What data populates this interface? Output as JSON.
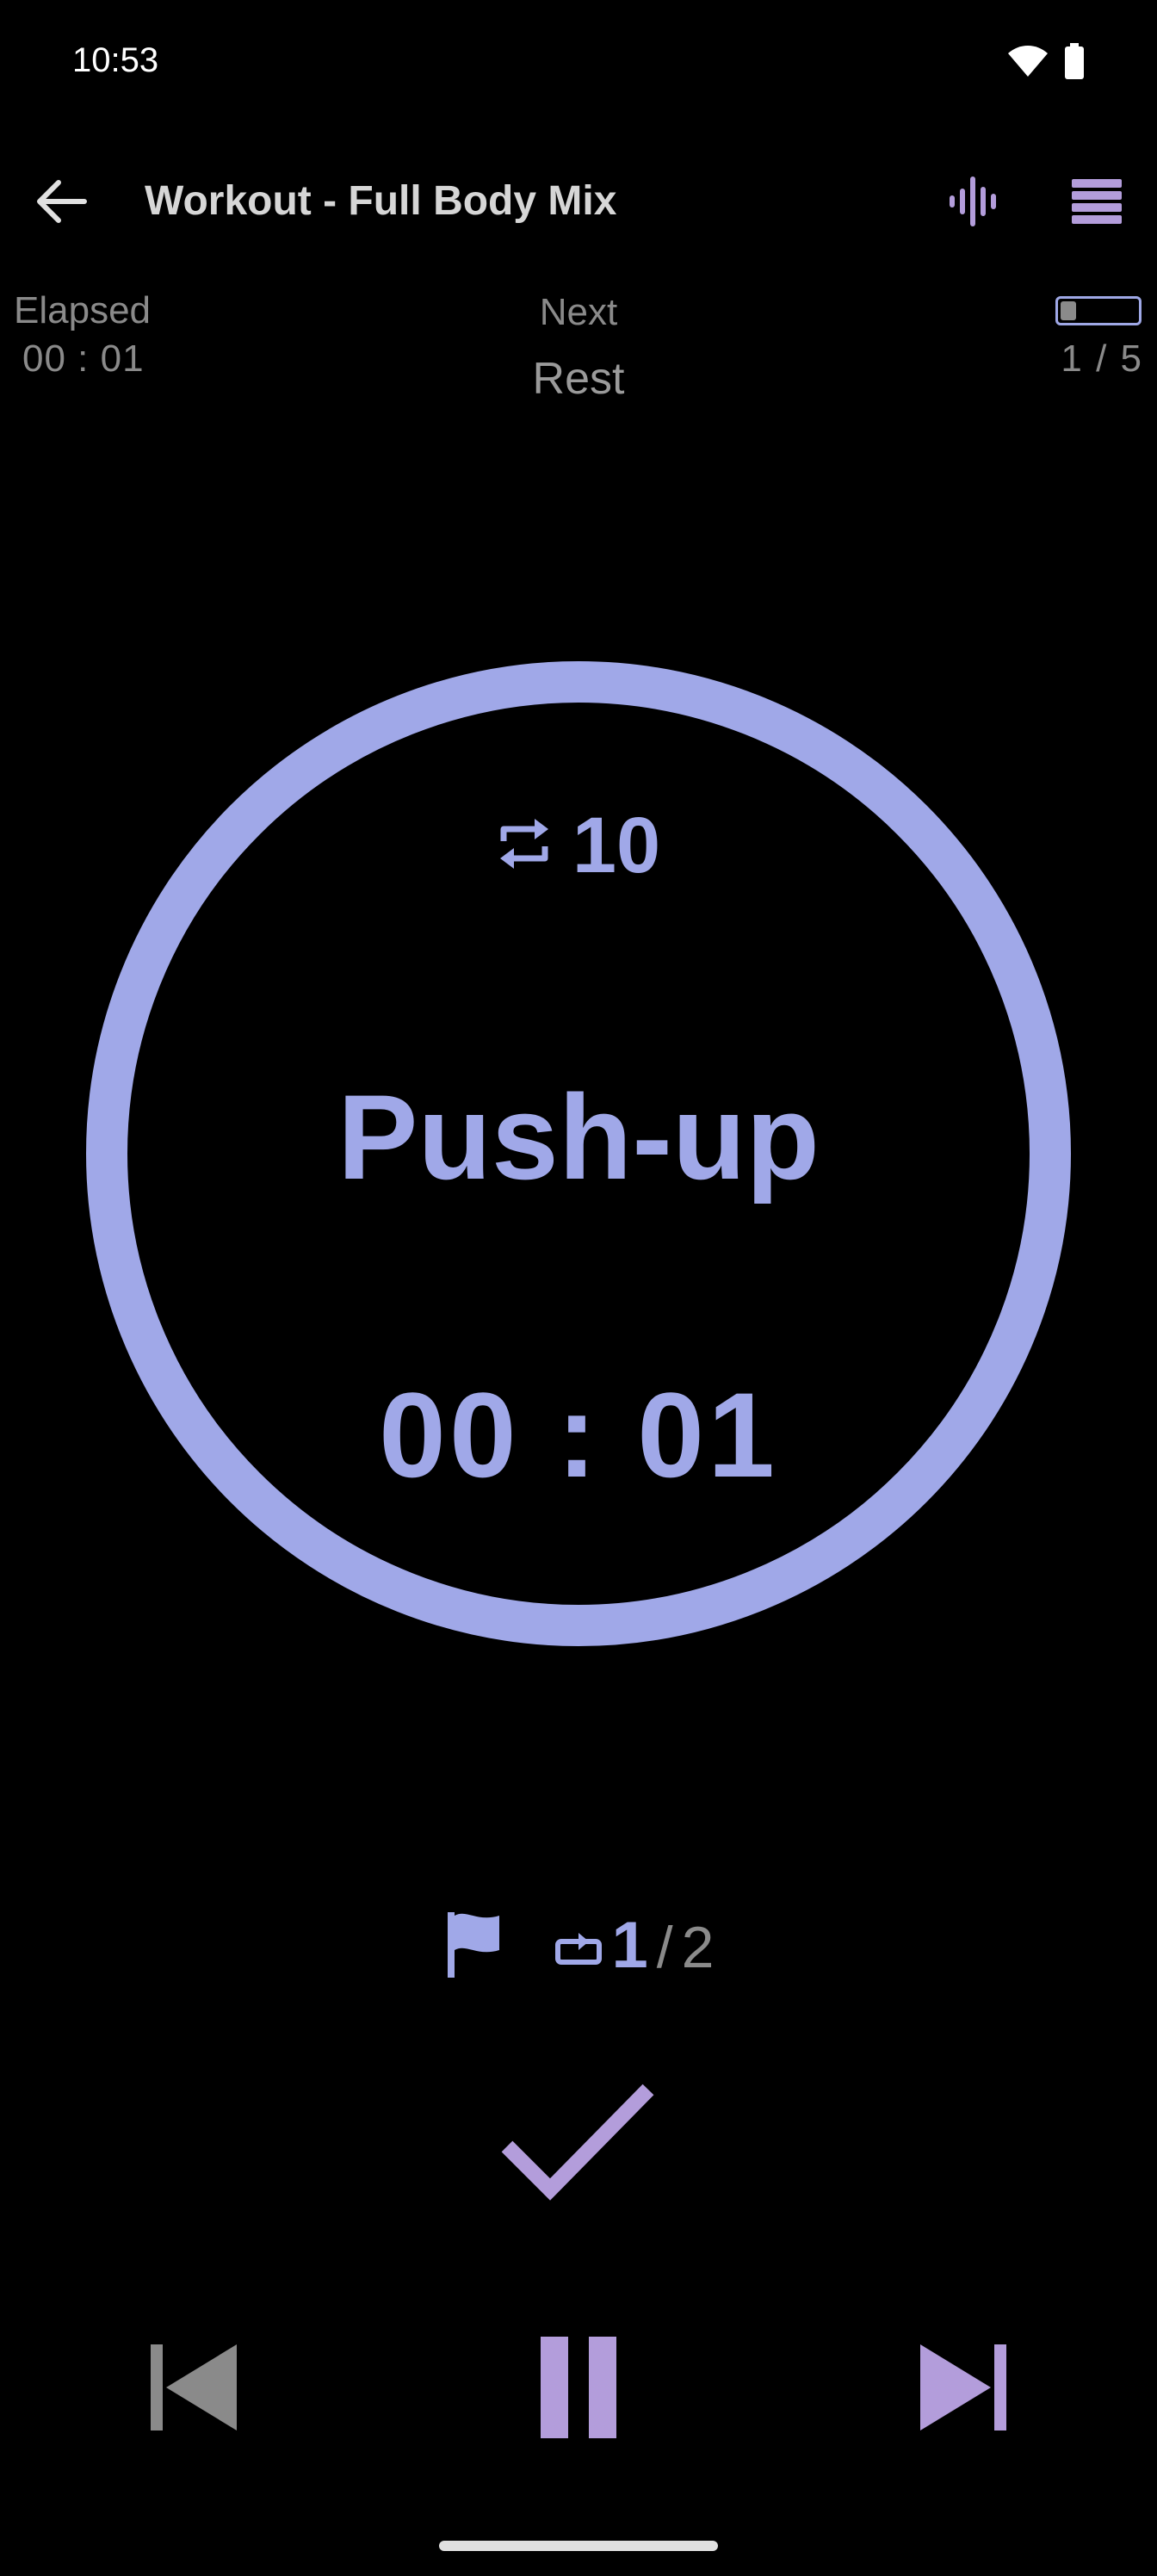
{
  "status_bar": {
    "time": "10:53",
    "icons": [
      "wifi-icon",
      "battery-icon"
    ]
  },
  "app_bar": {
    "title": "Workout - Full Body Mix",
    "icons": [
      "back-arrow-icon",
      "sound-wave-icon",
      "list-menu-icon"
    ]
  },
  "info": {
    "elapsed_label": "Elapsed",
    "elapsed_value": "00 : 01",
    "next_label": "Next",
    "next_value": "Rest",
    "progress_text": "1 / 5",
    "progress_fraction": 0.2
  },
  "exercise": {
    "reps": "10",
    "name": "Push-up",
    "timer": "00 : 01"
  },
  "sets": {
    "current": "1",
    "separator": "/",
    "total": "2"
  },
  "colors": {
    "accent": "#a0a8e8",
    "accent_purple": "#b39ddb",
    "muted": "#8a8a8a",
    "background": "#000000"
  }
}
